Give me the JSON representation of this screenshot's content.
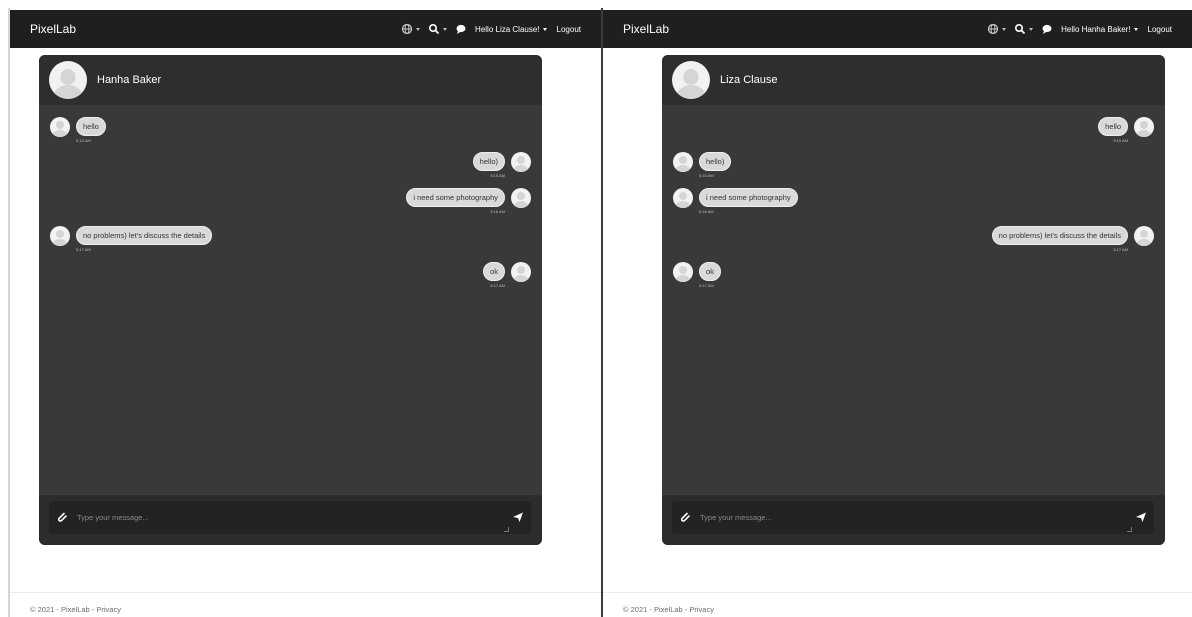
{
  "left": {
    "nav": {
      "brand": "PixelLab",
      "greeting": "Hello Liza Clause!",
      "logout": "Logout"
    },
    "chat": {
      "partner_name": "Hanha Baker",
      "messages": [
        {
          "text": "hello",
          "time": "5:15 AM",
          "dir": "in"
        },
        {
          "text": "hello)",
          "time": "5:15 AM",
          "dir": "out"
        },
        {
          "text": "i need some photography",
          "time": "5:16 AM",
          "dir": "out"
        },
        {
          "text": "no problems) let's discuss the details",
          "time": "5:17 AM",
          "dir": "in"
        },
        {
          "text": "ok",
          "time": "5:17 AM",
          "dir": "out"
        }
      ],
      "input_placeholder": "Type your message..."
    },
    "footer": "© 2021 - PixelLab - Privacy"
  },
  "right": {
    "nav": {
      "brand": "PixelLab",
      "greeting": "Hello Hanha Baker!",
      "logout": "Logout"
    },
    "chat": {
      "partner_name": "Liza Clause",
      "messages": [
        {
          "text": "hello",
          "time": "5:15 AM",
          "dir": "out"
        },
        {
          "text": "hello)",
          "time": "5:15 AM",
          "dir": "in"
        },
        {
          "text": "i need some photography",
          "time": "5:16 AM",
          "dir": "in"
        },
        {
          "text": "no problems) let's discuss the details",
          "time": "5:17 AM",
          "dir": "out"
        },
        {
          "text": "ok",
          "time": "5:17 AM",
          "dir": "in"
        }
      ],
      "input_placeholder": "Type your message..."
    },
    "footer": "© 2021 - PixelLab - Privacy"
  },
  "icons": {
    "globe": "globe-icon",
    "search": "search-icon",
    "chat": "chat-bubble-icon",
    "attach": "paperclip-icon",
    "send": "send-icon"
  },
  "colors": {
    "navbar": "#1f1f1f",
    "chat_bg": "#393939",
    "bubble": "#d9d9d9"
  }
}
